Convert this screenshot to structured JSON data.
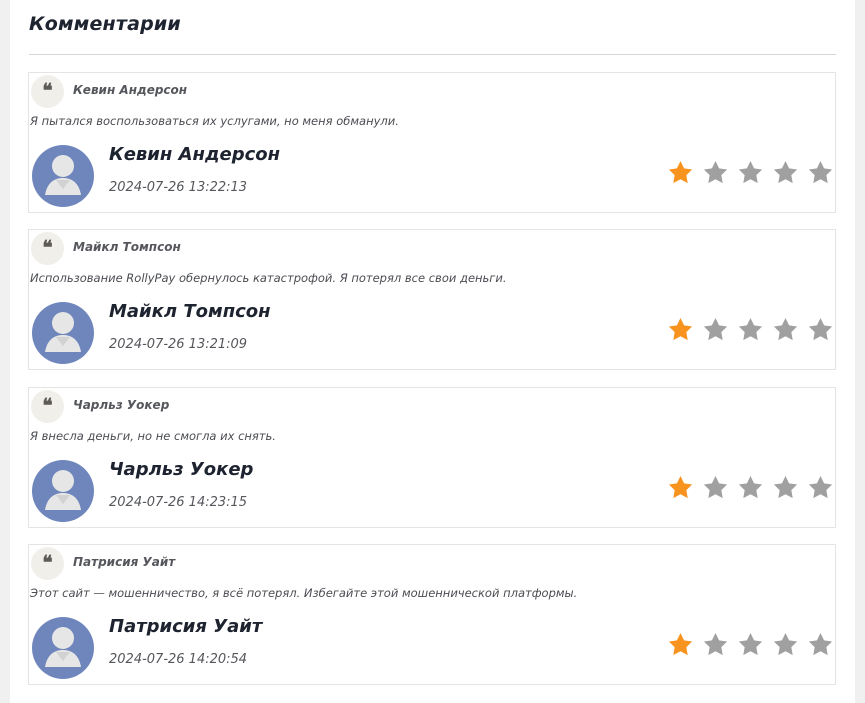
{
  "page": {
    "title": "Комментарии"
  },
  "comments": [
    {
      "quote_name": "Кевин Андерсон",
      "text": "Я пытался воспользоваться их услугами, но меня обманули.",
      "author": "Кевин Андерсон",
      "date": "2024-07-26 13:22:13",
      "rating": 1
    },
    {
      "quote_name": "Майкл Томпсон",
      "text": "Использование RollyPay обернулось катастрофой. Я потерял все свои деньги.",
      "author": "Майкл Томпсон",
      "date": "2024-07-26 13:21:09",
      "rating": 1
    },
    {
      "quote_name": "Чарльз Уокер",
      "text": "Я внесла деньги, но не смогла их снять.",
      "author": "Чарльз Уокер",
      "date": "2024-07-26 14:23:15",
      "rating": 1
    },
    {
      "quote_name": "Патрисия Уайт",
      "text": "Этот сайт — мошенничество, я всё потерял. Избегайте этой мошеннической платформы.",
      "author": "Патрисия Уайт",
      "date": "2024-07-26 14:20:54",
      "rating": 1
    }
  ],
  "rating_max": 5,
  "icons": {
    "quote": "quote-icon",
    "avatar": "user-avatar-icon",
    "star": "star-icon"
  },
  "colors": {
    "star_filled": "#f7931e",
    "star_empty": "#a0a0a0",
    "avatar_bg": "#6f86bd",
    "avatar_person": "#e6e6e6",
    "title": "#1e2330"
  }
}
